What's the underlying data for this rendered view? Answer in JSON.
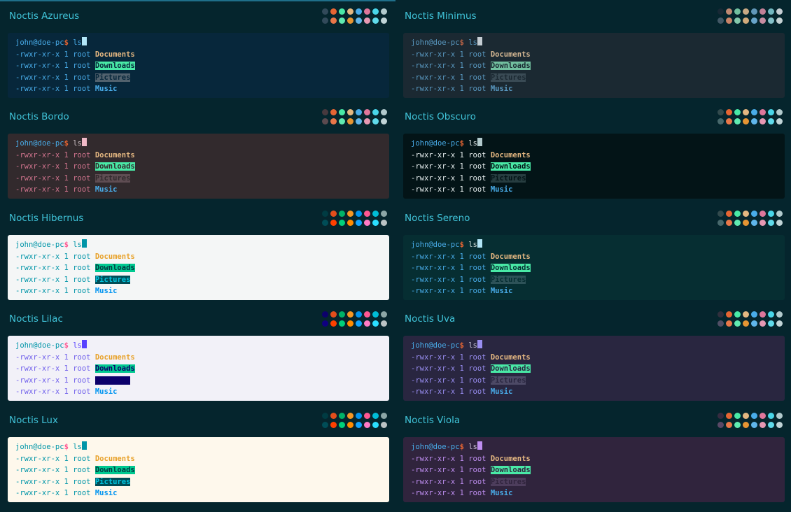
{
  "themes": [
    {
      "title": "Noctis Azureus",
      "col": 0,
      "row": 0,
      "bg": "#07273b",
      "user": "#49ace9",
      "at": "#49ace9",
      "host": "#49ace9",
      "dollar": "#e66533",
      "cmd": "#49ace9",
      "cursor": "#b2e6f7",
      "perm": "#49ace9",
      "docs": "#e4b781",
      "dl_bg": "#49e9a6",
      "dl_fg": "#07273b",
      "pic_bg": "#52626e",
      "pic_fg": "#07273b",
      "music": "#49ace9",
      "dots": [
        "#324a5a",
        "#e66533",
        "#49e9a6",
        "#e4b781",
        "#49ace9",
        "#df769b",
        "#49d6e9",
        "#b2cacd",
        "#324a5a",
        "#e97749",
        "#60ebb1",
        "#e69533",
        "#60b6eb",
        "#e798b3",
        "#60dbeb",
        "#c1d4d7"
      ]
    },
    {
      "title": "Noctis Minimus",
      "col": 1,
      "row": 0,
      "bg": "#1b2932",
      "user": "#5998c0",
      "at": "#5998c0",
      "host": "#5998c0",
      "dollar": "#b96346",
      "cmd": "#5998c0",
      "cursor": "#c5cdd3",
      "perm": "#5998c0",
      "docs": "#d3b692",
      "dl_bg": "#72c09f",
      "dl_fg": "#1b2932",
      "pic_bg": "#3a4b55",
      "pic_fg": "#1b2932",
      "music": "#5998c0",
      "dots": [
        "#182935",
        "#c08872",
        "#72c09f",
        "#c8a984",
        "#6196b8",
        "#c28097",
        "#72b7c0",
        "#c5cdd3",
        "#425866",
        "#ca8468",
        "#84c8ab",
        "#d1aa7b",
        "#68a4ca",
        "#c88da2",
        "#84c0c8",
        "#c5d1d3"
      ]
    },
    {
      "title": "Noctis Bordo",
      "col": 0,
      "row": 1,
      "bg": "#322a2d",
      "user": "#49ace9",
      "at": "#49ace9",
      "host": "#49ace9",
      "dollar": "#e66533",
      "cmd": "#cbbec2",
      "cursor": "#f0b9c7",
      "perm": "#d3758f",
      "docs": "#e4b781",
      "dl_bg": "#49e9a6",
      "dl_fg": "#322a2d",
      "pic_bg": "#5f4d53",
      "pic_fg": "#322a2d",
      "music": "#49ace9",
      "dots": [
        "#47393e",
        "#e66533",
        "#49e9a6",
        "#e4b781",
        "#49ace9",
        "#df769b",
        "#49d6e9",
        "#b2cacd",
        "#5b4a4f",
        "#e97749",
        "#60ebb1",
        "#e69533",
        "#60b6eb",
        "#e798b3",
        "#60dbeb",
        "#c1d4d7"
      ]
    },
    {
      "title": "Noctis Obscuro",
      "col": 1,
      "row": 1,
      "bg": "#031417",
      "user": "#49ace9",
      "at": "#49ace9",
      "host": "#49ace9",
      "dollar": "#e66533",
      "cmd": "#e8eff0",
      "cursor": "#b2cacd",
      "perm": "#e8eff0",
      "docs": "#e4b781",
      "dl_bg": "#49e9a6",
      "dl_fg": "#031417",
      "pic_bg": "#273d40",
      "pic_fg": "#031417",
      "music": "#49ace9",
      "dots": [
        "#324a4d",
        "#e66533",
        "#49e9a6",
        "#e4b781",
        "#49ace9",
        "#df769b",
        "#49d6e9",
        "#b2cacd",
        "#47686c",
        "#e97749",
        "#60ebb1",
        "#e69533",
        "#60b6eb",
        "#e798b3",
        "#60dbeb",
        "#c1d4d7"
      ]
    },
    {
      "title": "Noctis Hibernus",
      "col": 0,
      "row": 2,
      "bg": "#f4f6f6",
      "user": "#0095a8",
      "at": "#0095a8",
      "host": "#0095a8",
      "dollar": "#ff5792",
      "cmd": "#0095a8",
      "cursor": "#0095a8",
      "perm": "#0095a8",
      "docs": "#e8a22b",
      "dl_bg": "#00c990",
      "dl_fg": "#003b42",
      "pic_bg": "#004d57",
      "pic_fg": "#00c6e0",
      "music": "#0094f0",
      "dots": [
        "#003b42",
        "#e34e1c",
        "#00b368",
        "#f49725",
        "#0094f0",
        "#ff5792",
        "#00bdd6",
        "#8ca6a6",
        "#004d57",
        "#ff4000",
        "#00d17a",
        "#ff8c00",
        "#0fa3ff",
        "#ff7ac6",
        "#2bdfff",
        "#bbc3c4"
      ]
    },
    {
      "title": "Noctis Sereno",
      "col": 1,
      "row": 2,
      "bg": "#062e32",
      "user": "#49ace9",
      "at": "#49ace9",
      "host": "#49ace9",
      "dollar": "#e66533",
      "cmd": "#cfdbd8",
      "cursor": "#b2e6f7",
      "perm": "#49ace9",
      "docs": "#e4b781",
      "dl_bg": "#49e9a6",
      "dl_fg": "#062e32",
      "pic_bg": "#2d5258",
      "pic_fg": "#062e32",
      "music": "#49ace9",
      "dots": [
        "#324a4d",
        "#e66533",
        "#49e9a6",
        "#e4b781",
        "#49ace9",
        "#df769b",
        "#49d6e9",
        "#b2cacd",
        "#47686c",
        "#e97749",
        "#60ebb1",
        "#e69533",
        "#60b6eb",
        "#e798b3",
        "#60dbeb",
        "#c1d4d7"
      ]
    },
    {
      "title": "Noctis Lilac",
      "col": 0,
      "row": 3,
      "bg": "#f2f1f8",
      "user": "#0095a8",
      "at": "#0095a8",
      "host": "#0095a8",
      "dollar": "#ff5792",
      "cmd": "#5842ff",
      "cursor": "#5842ff",
      "perm": "#7060eb",
      "docs": "#e8a22b",
      "dl_bg": "#00c990",
      "dl_fg": "#0c006b",
      "pic_bg": "#0c006b",
      "pic_fg": "#0c006b",
      "music": "#0094f0",
      "dots": [
        "#0c006b",
        "#e34e1c",
        "#00b368",
        "#f49725",
        "#0094f0",
        "#ff5792",
        "#00bdd6",
        "#8ca6a6",
        "#0f0080",
        "#ff4000",
        "#00d17a",
        "#ff8c00",
        "#0fa3ff",
        "#ff7ac6",
        "#2bdfff",
        "#bbc3c4"
      ]
    },
    {
      "title": "Noctis Uva",
      "col": 1,
      "row": 3,
      "bg": "#292640",
      "user": "#49ace9",
      "at": "#49ace9",
      "host": "#49ace9",
      "dollar": "#e66533",
      "cmd": "#c5c2d6",
      "cursor": "#998ef1",
      "perm": "#998ef1",
      "docs": "#e4b781",
      "dl_bg": "#49e9a6",
      "dl_fg": "#292640",
      "pic_bg": "#4d4a66",
      "pic_fg": "#292640",
      "music": "#49ace9",
      "dots": [
        "#302f3d",
        "#e66533",
        "#49e9a6",
        "#e4b781",
        "#49ace9",
        "#df769b",
        "#49d6e9",
        "#b2cacd",
        "#504e65",
        "#e97749",
        "#60ebb1",
        "#e69533",
        "#60b6eb",
        "#e798b3",
        "#60dbeb",
        "#c1d4d7"
      ]
    },
    {
      "title": "Noctis Lux",
      "col": 0,
      "row": 4,
      "bg": "#fef8ec",
      "user": "#0095a8",
      "at": "#0095a8",
      "host": "#0095a8",
      "dollar": "#ff5792",
      "cmd": "#0095a8",
      "cursor": "#0095a8",
      "perm": "#0095a8",
      "docs": "#e8a22b",
      "dl_bg": "#00c990",
      "dl_fg": "#003b42",
      "pic_bg": "#004d57",
      "pic_fg": "#00c6e0",
      "music": "#0094f0",
      "dots": [
        "#003b42",
        "#e34e1c",
        "#00b368",
        "#f49725",
        "#0094f0",
        "#ff5792",
        "#00bdd6",
        "#8ca6a6",
        "#004d57",
        "#ff4000",
        "#00d17a",
        "#ff8c00",
        "#0fa3ff",
        "#ff7ac6",
        "#2bdfff",
        "#bbc3c4"
      ]
    },
    {
      "title": "Noctis Viola",
      "col": 1,
      "row": 4,
      "bg": "#30243d",
      "user": "#49ace9",
      "at": "#49ace9",
      "host": "#49ace9",
      "dollar": "#e66533",
      "cmd": "#ccbfd9",
      "cursor": "#bf8ef1",
      "perm": "#bf8ef1",
      "docs": "#e4b781",
      "dl_bg": "#49e9a6",
      "dl_fg": "#30243d",
      "pic_bg": "#4d3d5c",
      "pic_fg": "#30243d",
      "music": "#49ace9",
      "dots": [
        "#362b40",
        "#e66533",
        "#49e9a6",
        "#e4b781",
        "#49ace9",
        "#df769b",
        "#49d6e9",
        "#b2cacd",
        "#594866",
        "#e97749",
        "#60ebb1",
        "#e69533",
        "#60b6eb",
        "#e798b3",
        "#60dbeb",
        "#c1d4d7"
      ]
    }
  ],
  "terminal": {
    "user": "john",
    "at": "@",
    "host": "doe-pc",
    "dollar": "$",
    "command": "ls",
    "perm": "-rwxr-xr-x",
    "links": "1",
    "owner": "root",
    "files": [
      "Documents",
      "Downloads",
      "Pictures",
      "Music"
    ]
  }
}
